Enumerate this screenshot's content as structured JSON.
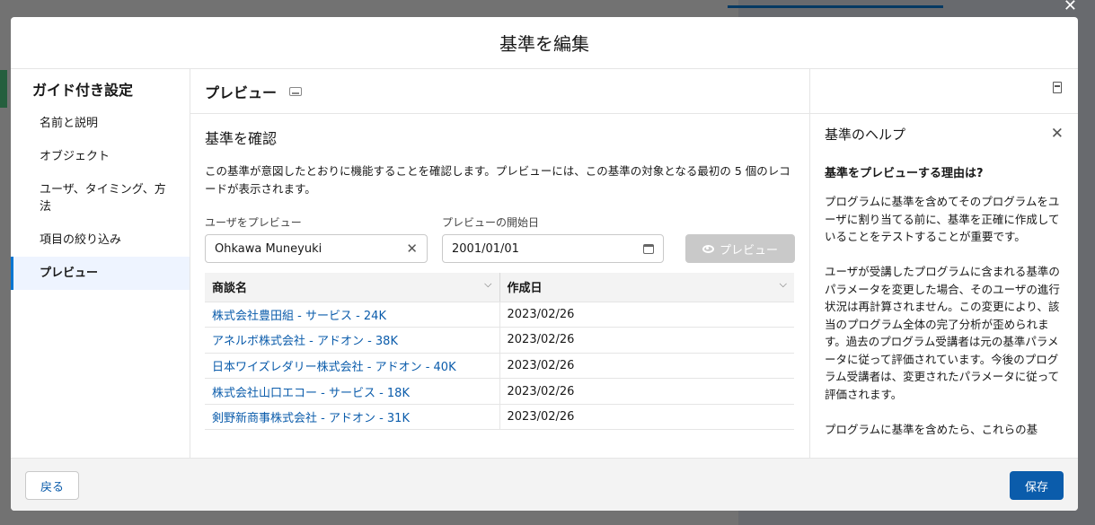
{
  "modal": {
    "title": "基準を編集"
  },
  "guide": {
    "title": "ガイド付き設定",
    "items": [
      {
        "label": "名前と説明"
      },
      {
        "label": "オブジェクト"
      },
      {
        "label": "ユーザ、タイミング、方法"
      },
      {
        "label": "項目の絞り込み"
      },
      {
        "label": "プレビュー"
      }
    ],
    "active_index": 4
  },
  "preview": {
    "title": "プレビュー",
    "section_title": "基準を確認",
    "description": "この基準が意図したとおりに機能することを確認します。プレビューには、この基準の対象となる最初の 5 個のレコードが表示されます。",
    "user_label": "ユーザをプレビュー",
    "user_value": "Ohkawa Muneyuki",
    "date_label": "プレビューの開始日",
    "date_value": "2001/01/01",
    "preview_button": "プレビュー",
    "table": {
      "columns": [
        "商談名",
        "作成日"
      ],
      "rows": [
        [
          "株式会社豊田組 - サービス - 24K",
          "2023/02/26"
        ],
        [
          "アネルボ株式会社 - アドオン - 38K",
          "2023/02/26"
        ],
        [
          "日本ワイズレダリー株式会社 - アドオン - 40K",
          "2023/02/26"
        ],
        [
          "株式会社山口エコー - サービス - 18K",
          "2023/02/26"
        ],
        [
          "剣野新商事株式会社 - アドオン - 31K",
          "2023/02/26"
        ]
      ]
    }
  },
  "help": {
    "title": "基準のヘルプ",
    "subtitle": "基準をプレビューする理由は?",
    "paragraphs": [
      "プログラムに基準を含めてそのプログラムをユーザに割り当てる前に、基準を正確に作成していることをテストすることが重要です。",
      "ユーザが受講したプログラムに含まれる基準のパラメータを変更した場合、そのユーザの進行状況は再計算されません。この変更により、該当のプログラム全体の完了分析が歪められます。過去のプログラム受講者は元の基準パラメータに従って評価されています。今後のプログラム受講者は、変更されたパラメータに従って評価されます。",
      "プログラムに基準を含めたら、これらの基"
    ]
  },
  "footer": {
    "back_label": "戻る",
    "save_label": "保存"
  }
}
